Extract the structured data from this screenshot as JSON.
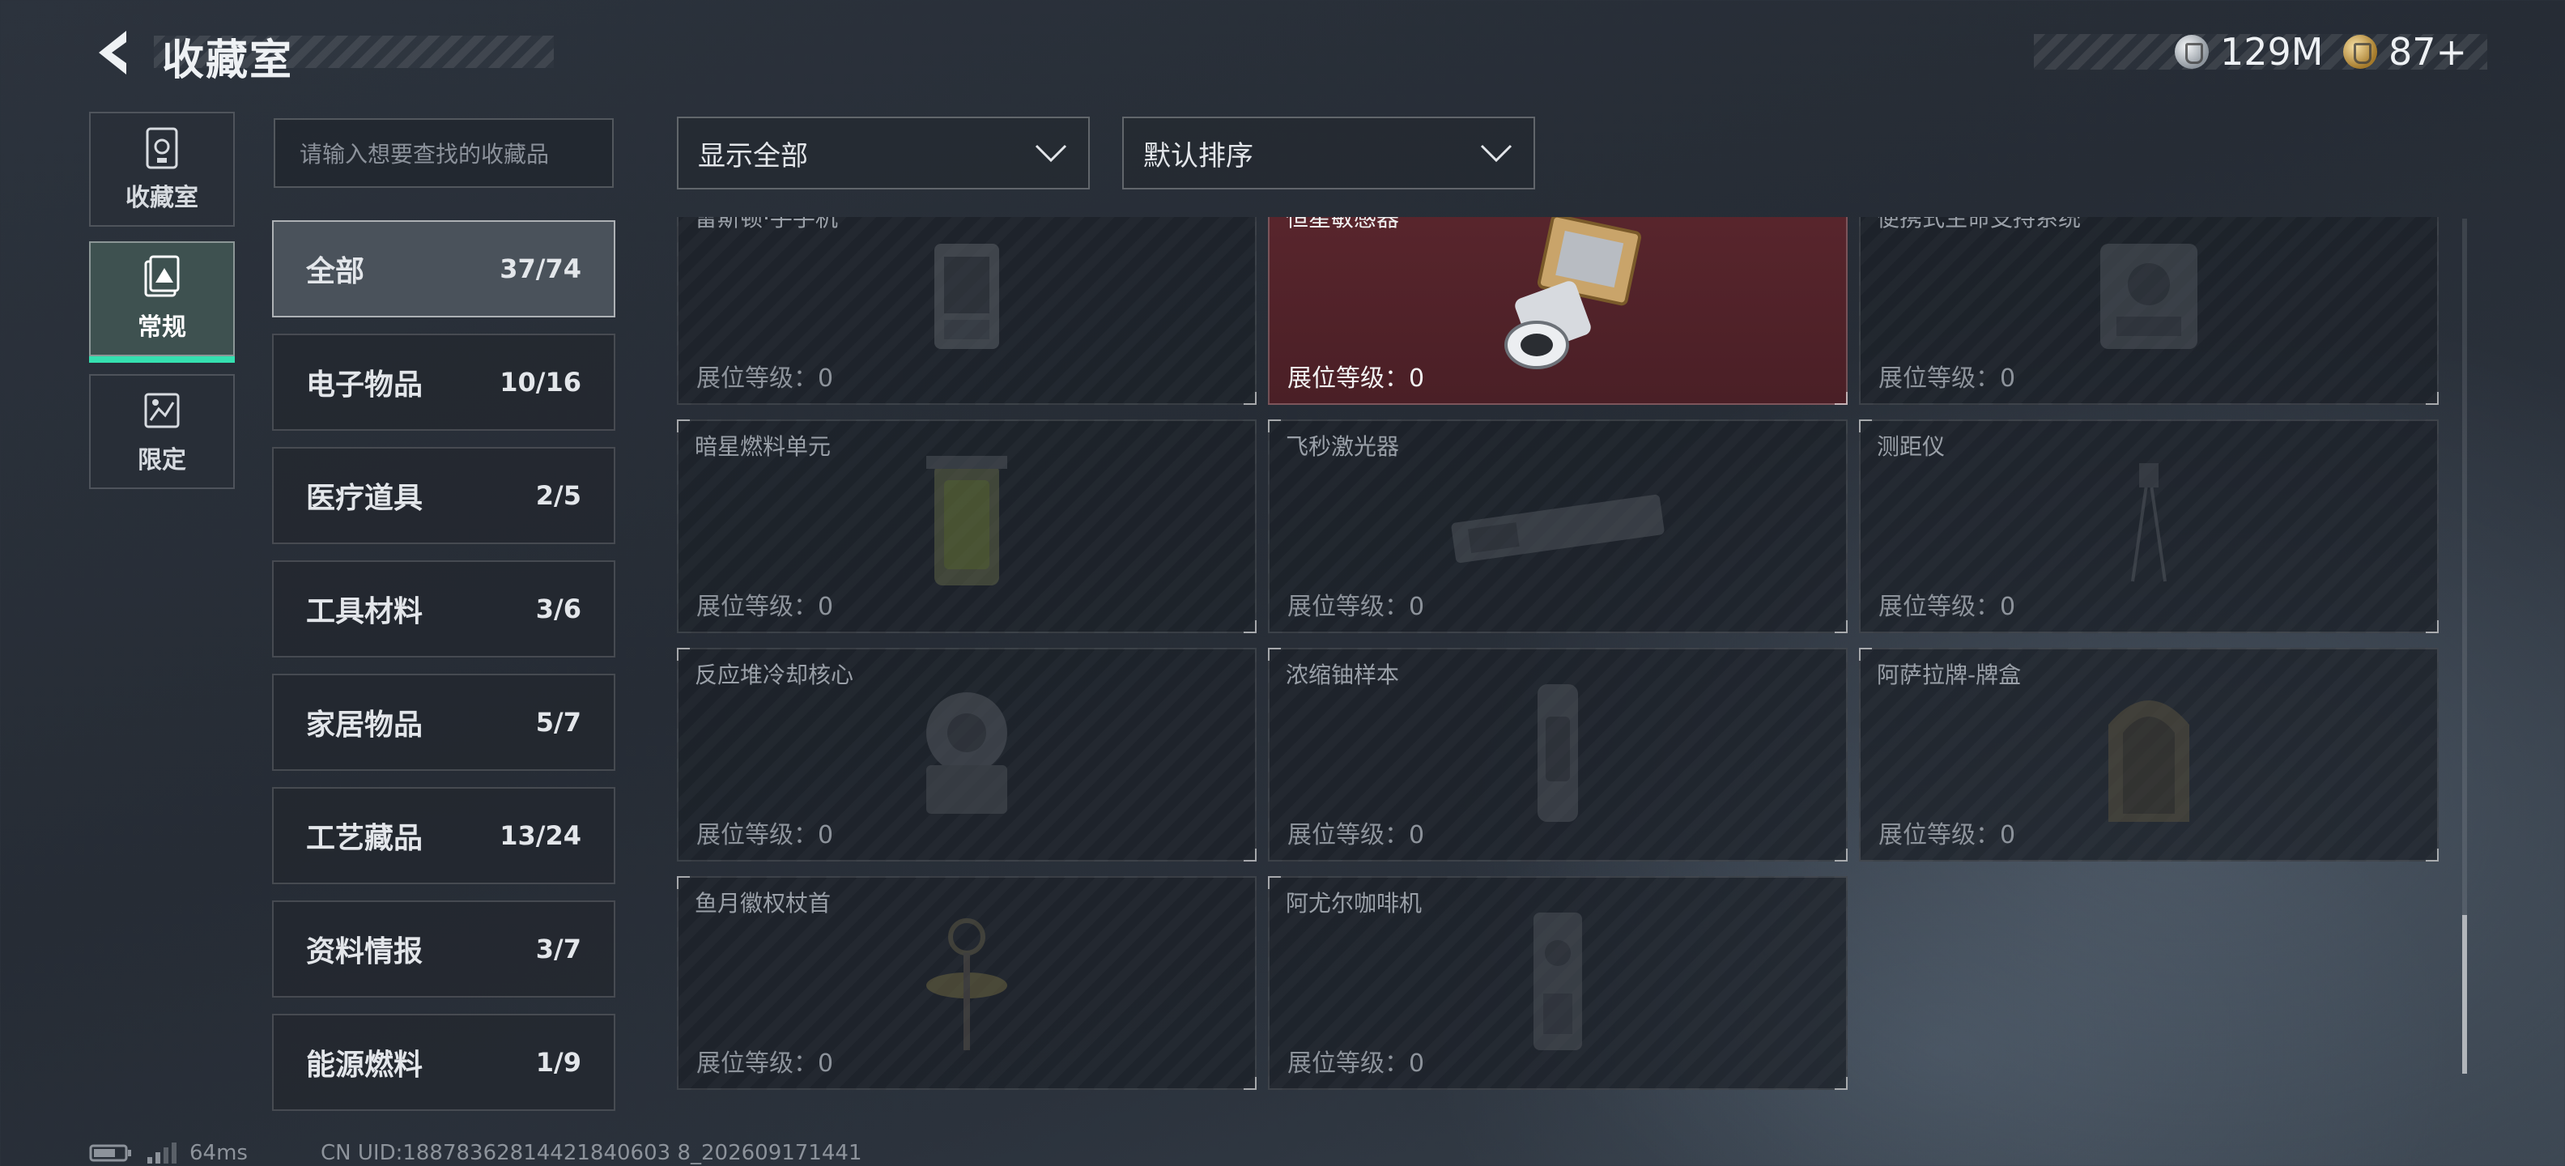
{
  "header": {
    "title": "收藏室",
    "currency_silver": "129M",
    "currency_gold": "87+"
  },
  "side_tabs": [
    {
      "label": "收藏室",
      "icon": "collection-room-icon",
      "active": false
    },
    {
      "label": "常规",
      "icon": "regular-icon",
      "active": true
    },
    {
      "label": "限定",
      "icon": "limited-icon",
      "active": false
    }
  ],
  "search": {
    "placeholder": "请输入想要查找的收藏品"
  },
  "filters": {
    "display": "显示全部",
    "sort": "默认排序"
  },
  "categories": [
    {
      "label": "全部",
      "count": "37/74",
      "active": true
    },
    {
      "label": "电子物品",
      "count": "10/16"
    },
    {
      "label": "医疗道具",
      "count": "2/5"
    },
    {
      "label": "工具材料",
      "count": "3/6"
    },
    {
      "label": "家居物品",
      "count": "5/7"
    },
    {
      "label": "工艺藏品",
      "count": "13/24"
    },
    {
      "label": "资料情报",
      "count": "3/7"
    },
    {
      "label": "能源燃料",
      "count": "1/9"
    }
  ],
  "items": [
    {
      "name": "雷斯顿·手手机",
      "level": "展位等级：0",
      "owned": false
    },
    {
      "name": "恒星敏感器",
      "level": "展位等级：0",
      "owned": true
    },
    {
      "name": "便携式生命支持系统",
      "level": "展位等级：0",
      "owned": false
    },
    {
      "name": "暗星燃料单元",
      "level": "展位等级：0",
      "owned": false
    },
    {
      "name": "飞秒激光器",
      "level": "展位等级：0",
      "owned": false
    },
    {
      "name": "测距仪",
      "level": "展位等级：0",
      "owned": false
    },
    {
      "name": "反应堆冷却核心",
      "level": "展位等级：0",
      "owned": false
    },
    {
      "name": "浓缩铀样本",
      "level": "展位等级：0",
      "owned": false
    },
    {
      "name": "阿萨拉牌-牌盒",
      "level": "展位等级：0",
      "owned": false
    },
    {
      "name": "鱼月徽权杖首",
      "level": "展位等级：0",
      "owned": false
    },
    {
      "name": "阿尤尔咖啡机",
      "level": "展位等级：0",
      "owned": false
    }
  ],
  "footer": {
    "ping": "64ms",
    "uid": "CN UID:18878362814421840603 8_202609171441"
  },
  "colors": {
    "accent": "#35e0b0",
    "owned_card": "#5a262d"
  }
}
